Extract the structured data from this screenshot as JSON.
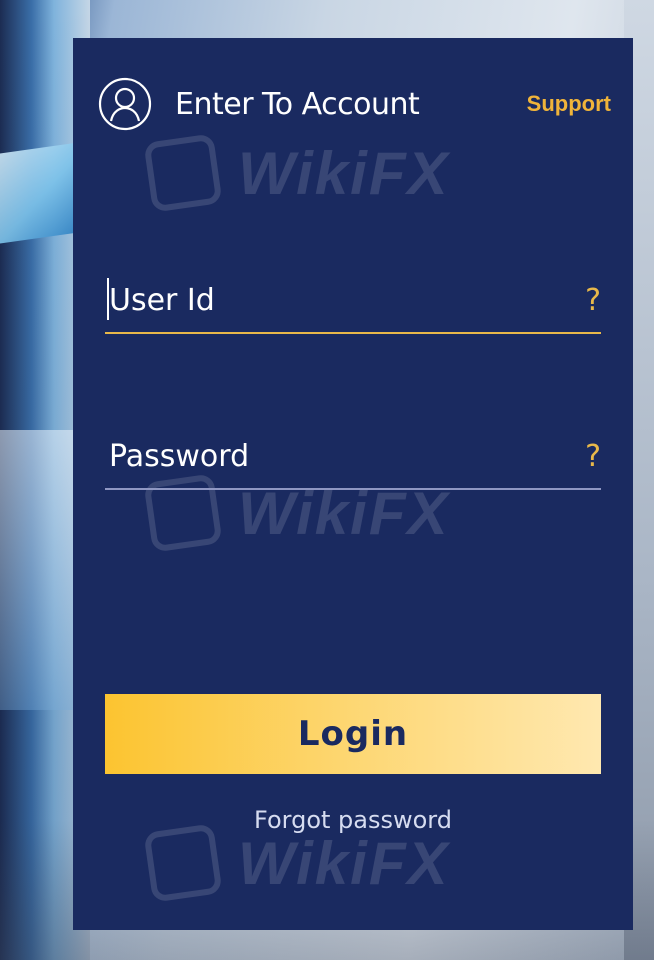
{
  "header": {
    "title": "Enter To Account",
    "support_label": "Support",
    "user_icon": "user-icon"
  },
  "form": {
    "user_id": {
      "placeholder": "User Id",
      "help": "?"
    },
    "password": {
      "placeholder": "Password",
      "help": "?"
    }
  },
  "actions": {
    "login_label": "Login",
    "forgot_label": "Forgot password"
  },
  "watermark": {
    "text": "WikiFX"
  },
  "colors": {
    "panel": "#1a2a60",
    "accent": "#f0b43a",
    "button_start": "#fcc430",
    "button_end": "#ffe8b0"
  }
}
